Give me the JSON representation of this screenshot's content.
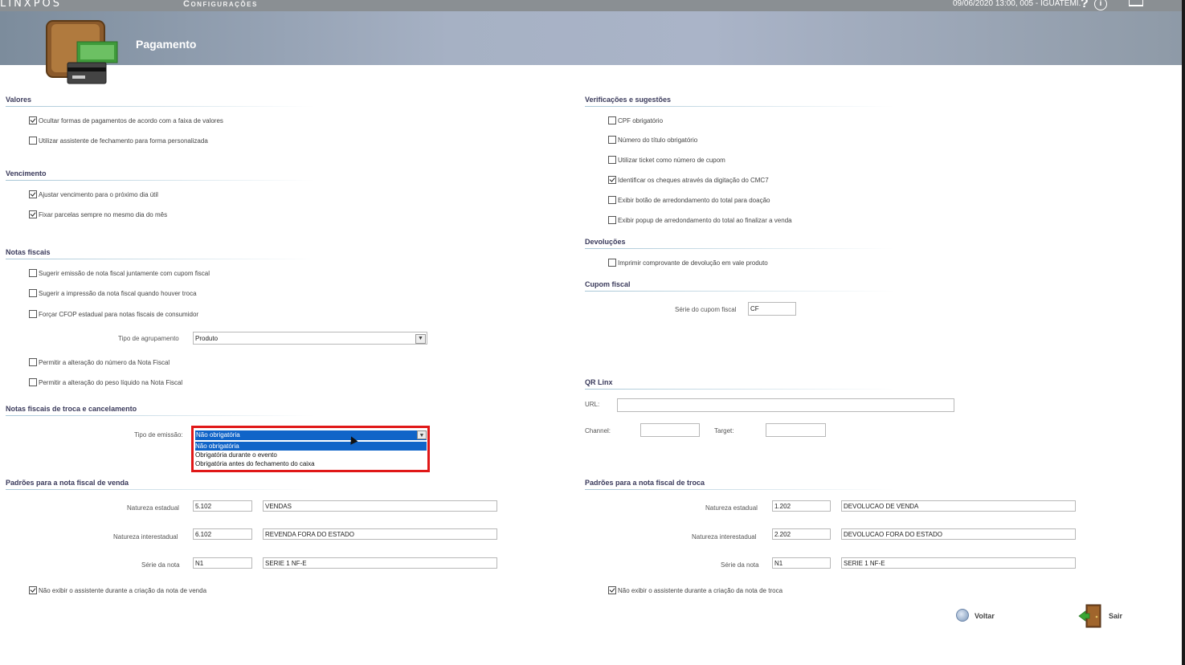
{
  "header": {
    "brand": "LINXPOS",
    "config_title": "Configurações",
    "status": "09/06/2020 13:00, 005 - IGUATEMI.",
    "help_glyph": "?",
    "info_glyph": "i",
    "page_title": "Pagamento"
  },
  "left": {
    "valores": {
      "title": "Valores",
      "items": [
        {
          "label": "Ocultar formas de pagamentos de acordo com a faixa de valores",
          "checked": true
        },
        {
          "label": "Utilizar assistente de fechamento para forma personalizada",
          "checked": false
        }
      ]
    },
    "vencimento": {
      "title": "Vencimento",
      "items": [
        {
          "label": "Ajustar vencimento para o próximo dia útil",
          "checked": true
        },
        {
          "label": "Fixar parcelas sempre no mesmo dia do mês",
          "checked": true
        }
      ]
    },
    "notas": {
      "title": "Notas fiscais",
      "items": [
        {
          "label": "Sugerir emissão de nota fiscal juntamente com cupom fiscal",
          "checked": false
        },
        {
          "label": "Sugerir a impressão da nota fiscal quando houver troca",
          "checked": false
        },
        {
          "label": "Forçar CFOP estadual para notas fiscais de consumidor",
          "checked": false
        }
      ],
      "agrupamento_label": "Tipo de agrupamento",
      "agrupamento_value": "Produto",
      "items2": [
        {
          "label": "Permitir a alteração do número da Nota Fiscal",
          "checked": false
        },
        {
          "label": "Permitir a alteração do peso líquido na Nota Fiscal",
          "checked": false
        }
      ]
    },
    "troca": {
      "title": "Notas fiscais de troca e cancelamento",
      "emissao_label": "Tipo de emissão:",
      "emissao_value": "Não obrigatória",
      "options": [
        "Não obrigatória",
        "Obrigatória durante o evento",
        "Obrigatória antes do fechamento do caixa"
      ]
    },
    "venda": {
      "title": "Padrões para a nota fiscal de venda",
      "rows": [
        {
          "label": "Natureza estadual",
          "code": "5.102",
          "desc": "VENDAS"
        },
        {
          "label": "Natureza interestadual",
          "code": "6.102",
          "desc": "REVENDA FORA DO ESTADO"
        },
        {
          "label": "Série da nota",
          "code": "N1",
          "desc": "SERIE 1 NF-E"
        }
      ],
      "check": {
        "label": "Não exibir o assistente durante a criação da nota de venda",
        "checked": true
      }
    }
  },
  "right": {
    "verif": {
      "title": "Verificações e sugestões",
      "items": [
        {
          "label": "CPF obrigatório",
          "checked": false
        },
        {
          "label": "Número do título obrigatório",
          "checked": false
        },
        {
          "label": "Utilizar ticket como número de cupom",
          "checked": false
        },
        {
          "label": "Identificar os cheques através da digitação do CMC7",
          "checked": true
        },
        {
          "label": "Exibir botão de arredondamento do total para doação",
          "checked": false
        },
        {
          "label": "Exibir popup de arredondamento do total ao finalizar a venda",
          "checked": false
        }
      ]
    },
    "devol": {
      "title": "Devoluções",
      "items": [
        {
          "label": "Imprimir comprovante de devolução em vale produto",
          "checked": false
        }
      ]
    },
    "cupom": {
      "title": "Cupom fiscal",
      "serie_label": "Série do cupom fiscal",
      "serie_value": "CF"
    },
    "qr": {
      "title": "QR Linx",
      "url_label": "URL:",
      "url_value": "",
      "channel_label": "Channel:",
      "channel_value": "",
      "target_label": "Target:",
      "target_value": ""
    },
    "troca": {
      "title": "Padrões para a nota fiscal de troca",
      "rows": [
        {
          "label": "Natureza estadual",
          "code": "1.202",
          "desc": "DEVOLUCAO DE VENDA"
        },
        {
          "label": "Natureza interestadual",
          "code": "2.202",
          "desc": "DEVOLUCAO FORA DO ESTADO"
        },
        {
          "label": "Série da nota",
          "code": "N1",
          "desc": "SERIE 1 NF-E"
        }
      ],
      "check": {
        "label": "Não exibir o assistente durante a criação da nota de troca",
        "checked": true
      }
    }
  },
  "footer": {
    "voltar": "Voltar",
    "sair": "Sair"
  }
}
